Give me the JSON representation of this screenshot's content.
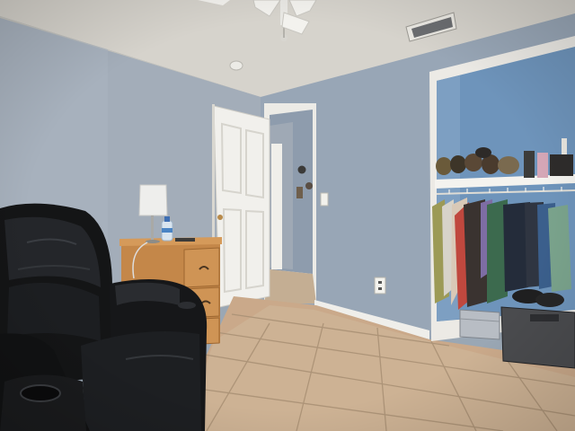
{
  "scene": {
    "description_visible_text": "",
    "palette": {
      "wall": "#9aa8b8",
      "wall_shadow": "#8793a2",
      "ceiling": "#d9d6cf",
      "floor": "#c9b49a",
      "grout": "#a8947c",
      "door": "#f1f0ec",
      "trim": "#ecebe6",
      "chair": "#151617",
      "nightstand": "#c8894c",
      "closet_back": "#6e93b8"
    },
    "objects": [
      {
        "name": "ceiling-fan"
      },
      {
        "name": "air-vent"
      },
      {
        "name": "smoke-detector"
      },
      {
        "name": "open-door"
      },
      {
        "name": "hallway"
      },
      {
        "name": "light-switch"
      },
      {
        "name": "wall-outlet"
      },
      {
        "name": "closet"
      },
      {
        "name": "closet-shelf-with-shoes"
      },
      {
        "name": "hanging-clothes"
      },
      {
        "name": "storage-bin"
      },
      {
        "name": "nightstand"
      },
      {
        "name": "table-lamp"
      },
      {
        "name": "water-bottle"
      },
      {
        "name": "leather-recliner"
      },
      {
        "name": "tile-floor"
      }
    ]
  }
}
